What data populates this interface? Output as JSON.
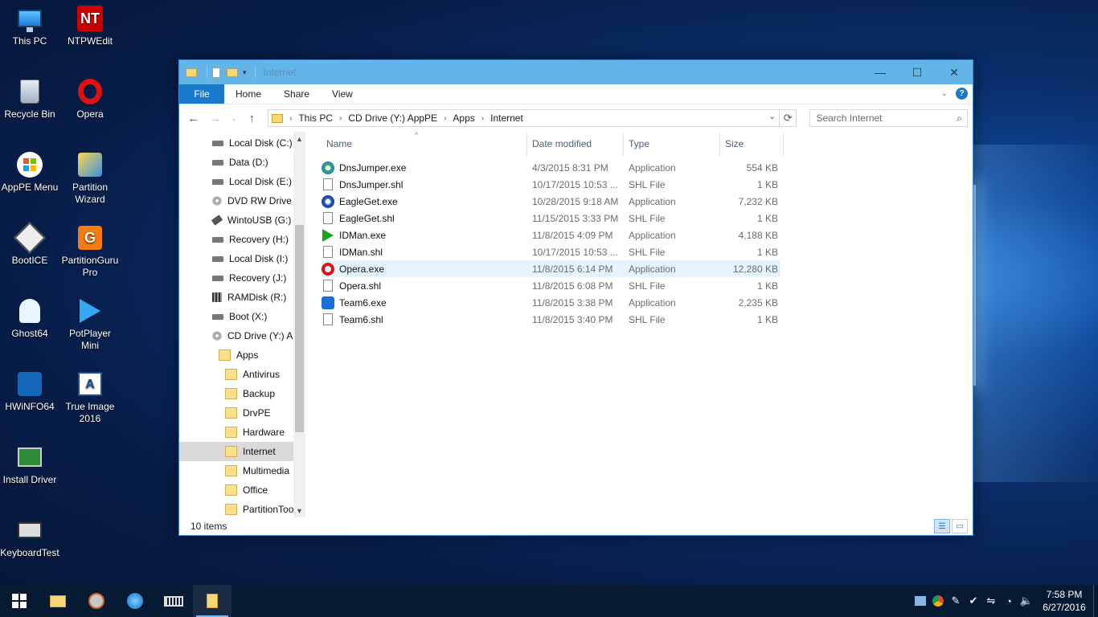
{
  "desktop": {
    "icons": [
      {
        "label": "This PC",
        "icon": "computer-icon"
      },
      {
        "label": "NTPWEdit",
        "icon": "ntpwedit-icon"
      },
      {
        "label": "Recycle Bin",
        "icon": "recycle-bin-icon"
      },
      {
        "label": "Opera",
        "icon": "opera-icon"
      },
      {
        "label": "AppPE Menu",
        "icon": "windows-logo-icon"
      },
      {
        "label": "Partition Wizard",
        "icon": "partition-wizard-icon"
      },
      {
        "label": "BootICE",
        "icon": "bootice-icon"
      },
      {
        "label": "PartitionGuru Pro",
        "icon": "partitionguru-icon"
      },
      {
        "label": "Ghost64",
        "icon": "ghost-icon"
      },
      {
        "label": "PotPlayer Mini",
        "icon": "potplayer-icon"
      },
      {
        "label": "HWiNFO64",
        "icon": "hwinfo-icon"
      },
      {
        "label": "True Image 2016",
        "icon": "true-image-icon"
      },
      {
        "label": "Install Driver",
        "icon": "driver-card-icon"
      },
      {
        "label": "KeyboardTest",
        "icon": "keyboard-icon"
      }
    ]
  },
  "explorer": {
    "title": "Internet",
    "ribbon_tabs": [
      "File",
      "Home",
      "Share",
      "View"
    ],
    "breadcrumb": [
      "This PC",
      "CD Drive (Y:) AppPE",
      "Apps",
      "Internet"
    ],
    "search_placeholder": "Search Internet",
    "nav": [
      {
        "label": "Local Disk (C:)",
        "kind": "drive",
        "indent": 0
      },
      {
        "label": "Data (D:)",
        "kind": "drive",
        "indent": 0
      },
      {
        "label": "Local Disk (E:)",
        "kind": "drive",
        "indent": 0
      },
      {
        "label": "DVD RW Drive",
        "kind": "dvd",
        "indent": 0
      },
      {
        "label": "WintoUSB (G:)",
        "kind": "usb",
        "indent": 0
      },
      {
        "label": "Recovery (H:)",
        "kind": "drive",
        "indent": 0
      },
      {
        "label": "Local Disk (I:)",
        "kind": "drive",
        "indent": 0
      },
      {
        "label": "Recovery (J:)",
        "kind": "drive",
        "indent": 0
      },
      {
        "label": "RAMDisk (R:)",
        "kind": "ram",
        "indent": 0
      },
      {
        "label": "Boot (X:)",
        "kind": "drive",
        "indent": 0
      },
      {
        "label": "CD Drive (Y:) A",
        "kind": "dvd",
        "indent": 0
      },
      {
        "label": "Apps",
        "kind": "folder",
        "indent": 1
      },
      {
        "label": "Antivirus",
        "kind": "folder",
        "indent": 2
      },
      {
        "label": "Backup",
        "kind": "folder",
        "indent": 2
      },
      {
        "label": "DrvPE",
        "kind": "folder",
        "indent": 2
      },
      {
        "label": "Hardware",
        "kind": "folder",
        "indent": 2
      },
      {
        "label": "Internet",
        "kind": "folder",
        "indent": 2,
        "selected": true
      },
      {
        "label": "Multimedia",
        "kind": "folder",
        "indent": 2
      },
      {
        "label": "Office",
        "kind": "folder",
        "indent": 2
      },
      {
        "label": "PartitionToo",
        "kind": "folder",
        "indent": 2
      }
    ],
    "columns": [
      "Name",
      "Date modified",
      "Type",
      "Size"
    ],
    "files": [
      {
        "name": "DnsJumper.exe",
        "date": "4/3/2015 8:31 PM",
        "type": "Application",
        "size": "554 KB",
        "icon": "dnsjumper-icon"
      },
      {
        "name": "DnsJumper.shl",
        "date": "10/17/2015 10:53 ...",
        "type": "SHL File",
        "size": "1 KB",
        "icon": "file-icon"
      },
      {
        "name": "EagleGet.exe",
        "date": "10/28/2015 9:18 AM",
        "type": "Application",
        "size": "7,232 KB",
        "icon": "eagleget-icon"
      },
      {
        "name": "EagleGet.shl",
        "date": "11/15/2015 3:33 PM",
        "type": "SHL File",
        "size": "1 KB",
        "icon": "file-icon"
      },
      {
        "name": "IDMan.exe",
        "date": "11/8/2015 4:09 PM",
        "type": "Application",
        "size": "4,188 KB",
        "icon": "idm-icon"
      },
      {
        "name": "IDMan.shl",
        "date": "10/17/2015 10:53 ...",
        "type": "SHL File",
        "size": "1 KB",
        "icon": "file-icon"
      },
      {
        "name": "Opera.exe",
        "date": "11/8/2015 6:14 PM",
        "type": "Application",
        "size": "12,280 KB",
        "icon": "opera-icon",
        "hover": true
      },
      {
        "name": "Opera.shl",
        "date": "11/8/2015 6:08 PM",
        "type": "SHL File",
        "size": "1 KB",
        "icon": "file-icon"
      },
      {
        "name": "Team6.exe",
        "date": "11/8/2015 3:38 PM",
        "type": "Application",
        "size": "2,235 KB",
        "icon": "teamviewer-icon"
      },
      {
        "name": "Team6.shl",
        "date": "11/8/2015 3:40 PM",
        "type": "SHL File",
        "size": "1 KB",
        "icon": "file-icon"
      }
    ],
    "status": "10 items"
  },
  "taskbar": {
    "time": "7:58 PM",
    "date": "6/27/2016"
  }
}
